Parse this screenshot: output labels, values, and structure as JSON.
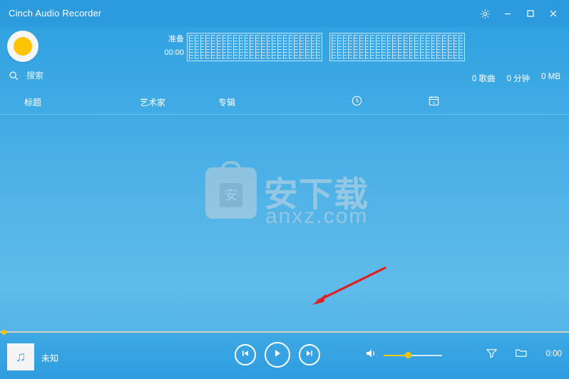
{
  "window": {
    "title": "Cinch Audio Recorder",
    "controls": {
      "settings": "gear-icon",
      "minimize": "minimize-icon",
      "maximize": "maximize-icon",
      "close": "close-icon"
    }
  },
  "recorder": {
    "record_button": "record-button",
    "status_label": "准备",
    "elapsed_time": "00:00",
    "meter_count": 2
  },
  "search": {
    "placeholder": "搜索",
    "value": ""
  },
  "stats": {
    "songs": "0 歌曲",
    "duration": "0 分钟",
    "size": "0 MB"
  },
  "columns": {
    "title": "标题",
    "artist": "艺术家",
    "album": "专辑",
    "duration_icon": "clock-icon",
    "date_icon": "calendar-icon"
  },
  "watermark": {
    "main": "安下载",
    "sub": "anxz.com"
  },
  "player": {
    "now_playing": "未知",
    "previous": "previous-icon",
    "play": "play-icon",
    "next": "next-icon",
    "volume_icon": "volume-icon",
    "volume_percent": 40,
    "filter_icon": "filter-icon",
    "folder_icon": "folder-icon",
    "time": "0:00",
    "seek_percent": 0
  },
  "colors": {
    "accent": "#ffc400",
    "background": "#4aaee6",
    "titlebar": "#2b9bdd",
    "text": "#ffffff",
    "meter_grid": "#bfe3f7",
    "arrow": "#e02020"
  }
}
